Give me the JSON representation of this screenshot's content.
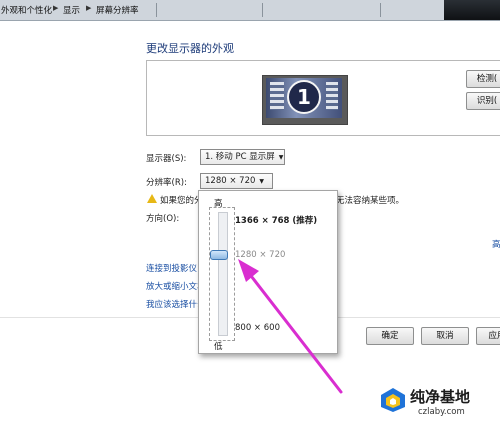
{
  "breadcrumb": {
    "items": [
      "外观和个性化",
      "显示",
      "屏幕分辨率"
    ]
  },
  "page_title": "更改显示器的外观",
  "monitor": {
    "number_label": "1"
  },
  "buttons": {
    "detect": "检测(",
    "identify": "识别(",
    "ok": "确定",
    "cancel": "取消",
    "apply": "应用"
  },
  "display_row": {
    "label": "显示器(S):",
    "value": "1. 移动 PC 显示屏"
  },
  "resolution_row": {
    "label": "分辨率(R):",
    "value": "1280 × 720"
  },
  "warning": {
    "left_text": "如果您的分",
    "right_text": "无法容纳某些项。"
  },
  "orientation": {
    "label": "方向(O):"
  },
  "advanced_link_partial": "高",
  "links": [
    "连接到投影仪",
    "放大或缩小文本",
    "我应该选择什么"
  ],
  "resolution_popup": {
    "high_label": "高",
    "low_label": "低",
    "options": [
      "1366 × 768 (推荐)",
      "1280 × 720",
      "800 × 600"
    ],
    "selected": "1280 × 720"
  },
  "watermark": {
    "title": "纯净基地",
    "url": "czlaby.com"
  },
  "colors": {
    "arrow": "#d92ed0",
    "link": "#1a4fa3",
    "title": "#1d3b79",
    "logo_blue": "#1f73d8",
    "logo_yellow": "#f6c31c"
  }
}
